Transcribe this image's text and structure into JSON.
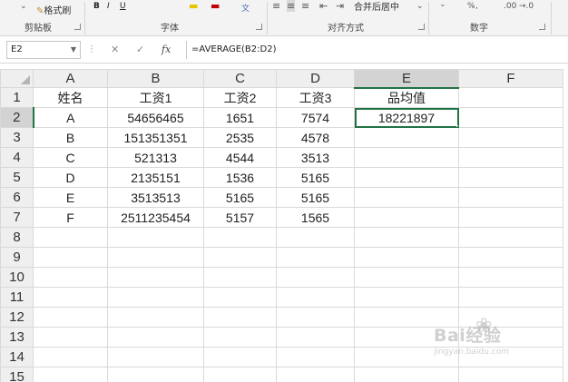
{
  "ribbon": {
    "clipboard": {
      "format_painter_label": "格式刷",
      "group_label": "剪贴板"
    },
    "font": {
      "group_label": "字体"
    },
    "alignment": {
      "merge_label": "合并后居中",
      "group_label": "对齐方式"
    },
    "number": {
      "group_label": "数字",
      "percent": "%",
      "decimals_inc": ".00",
      "decimals_dec": "→.0"
    }
  },
  "formula_bar": {
    "name_box": "E2",
    "cancel_icon": "✕",
    "enter_icon": "✓",
    "fx_label": "fx",
    "formula": "=AVERAGE(B2:D2)"
  },
  "sheet": {
    "columns": [
      "A",
      "B",
      "C",
      "D",
      "E",
      "F"
    ],
    "rows": [
      {
        "num": "1",
        "cells": [
          "姓名",
          "工资1",
          "工资2",
          "工资3",
          "品均值",
          ""
        ]
      },
      {
        "num": "2",
        "cells": [
          "A",
          "54656465",
          "1651",
          "7574",
          "18221897",
          ""
        ]
      },
      {
        "num": "3",
        "cells": [
          "B",
          "151351351",
          "2535",
          "4578",
          "",
          ""
        ]
      },
      {
        "num": "4",
        "cells": [
          "C",
          "521313",
          "4544",
          "3513",
          "",
          ""
        ]
      },
      {
        "num": "5",
        "cells": [
          "D",
          "2135151",
          "1536",
          "5165",
          "",
          ""
        ]
      },
      {
        "num": "6",
        "cells": [
          "E",
          "3513513",
          "5165",
          "5165",
          "",
          ""
        ]
      },
      {
        "num": "7",
        "cells": [
          "F",
          "2511235454",
          "5157",
          "1565",
          "",
          ""
        ]
      },
      {
        "num": "8",
        "cells": [
          "",
          "",
          "",
          "",
          "",
          ""
        ]
      },
      {
        "num": "9",
        "cells": [
          "",
          "",
          "",
          "",
          "",
          ""
        ]
      },
      {
        "num": "10",
        "cells": [
          "",
          "",
          "",
          "",
          "",
          ""
        ]
      },
      {
        "num": "11",
        "cells": [
          "",
          "",
          "",
          "",
          "",
          ""
        ]
      },
      {
        "num": "12",
        "cells": [
          "",
          "",
          "",
          "",
          "",
          ""
        ]
      },
      {
        "num": "13",
        "cells": [
          "",
          "",
          "",
          "",
          "",
          ""
        ]
      },
      {
        "num": "14",
        "cells": [
          "",
          "",
          "",
          "",
          "",
          ""
        ]
      },
      {
        "num": "15",
        "cells": [
          "",
          "",
          "",
          "",
          "",
          ""
        ]
      }
    ],
    "active_cell": "E2",
    "accent_color": "#217346"
  },
  "watermark": {
    "main": "Bai经验",
    "sub": "jingyan.baidu.com"
  }
}
